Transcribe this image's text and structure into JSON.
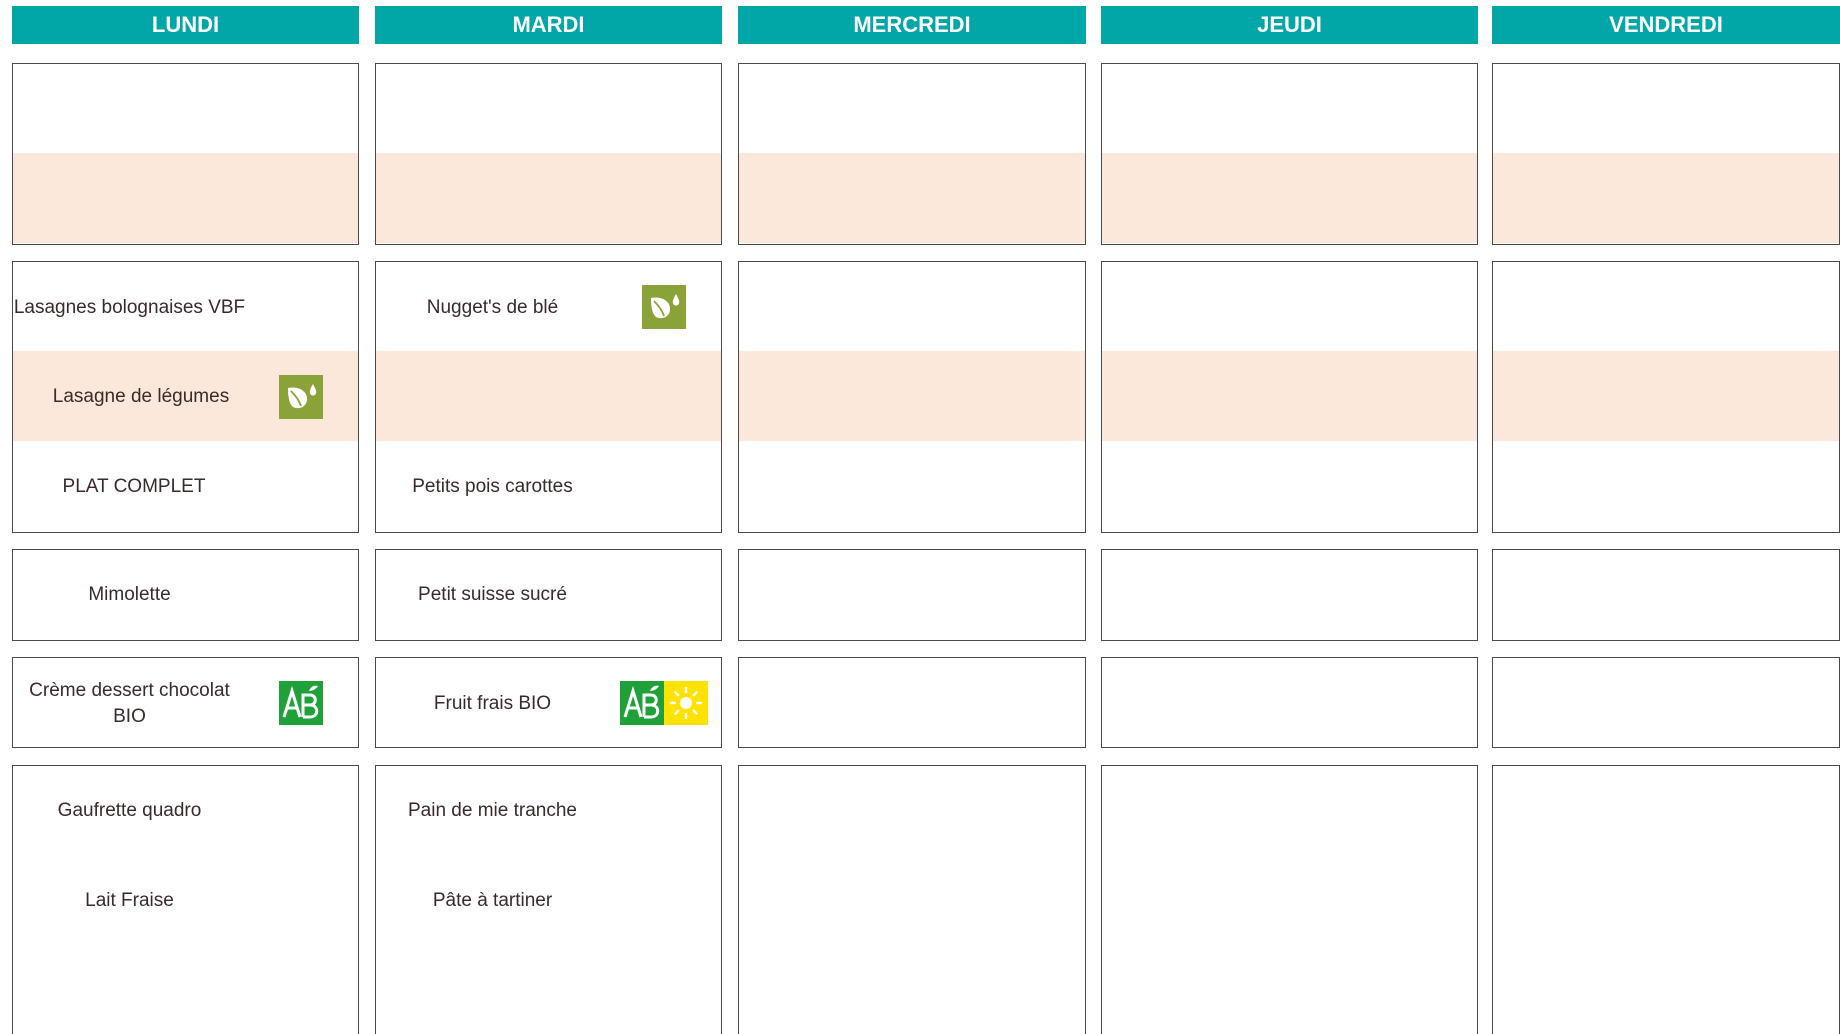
{
  "colors": {
    "header": "#00a7a6",
    "band": "#fce8da",
    "border": "#4a4a4a",
    "text": "#3a2a2a",
    "leaf": "#8aa339",
    "ab_green": "#1fa038",
    "sun": "#ffe200"
  },
  "days": [
    "LUNDI",
    "MARDI",
    "MERCREDI",
    "JEUDI",
    "VENDREDI"
  ],
  "monday": {
    "main_1": "Lasagnes bolognaises VBF",
    "main_2": "Lasagne de légumes",
    "side": "PLAT COMPLET",
    "cheese": "Mimolette",
    "dessert_line1": "Crème dessert chocolat",
    "dessert_line2": "BIO",
    "snack_1": "Gaufrette quadro",
    "snack_2": "Lait Fraise"
  },
  "tuesday": {
    "main_1": "Nugget's de blé",
    "side": "Petits pois carottes",
    "cheese": "Petit suisse sucré",
    "dessert": "Fruit frais BIO",
    "snack_1": "Pain de mie tranche",
    "snack_2": "Pâte à tartiner"
  },
  "icons": {
    "vegetarian": "leaf-drop-icon",
    "organic": "ab-agriculture-biologique-icon",
    "local": "sun-icon"
  }
}
